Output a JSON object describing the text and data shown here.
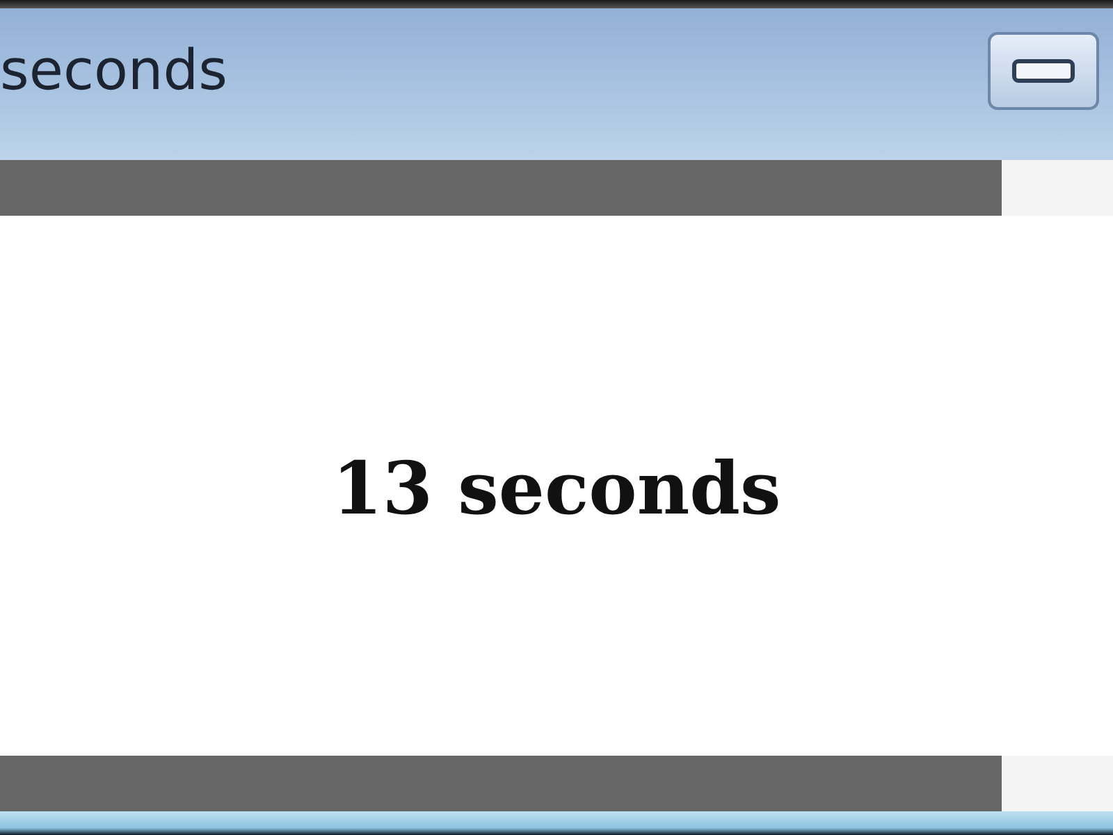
{
  "window": {
    "title": "seconds"
  },
  "top_progress": {
    "level": 0.9
  },
  "countdown": {
    "text": "13 seconds"
  },
  "bottom_progress": {
    "level": 0.9
  }
}
